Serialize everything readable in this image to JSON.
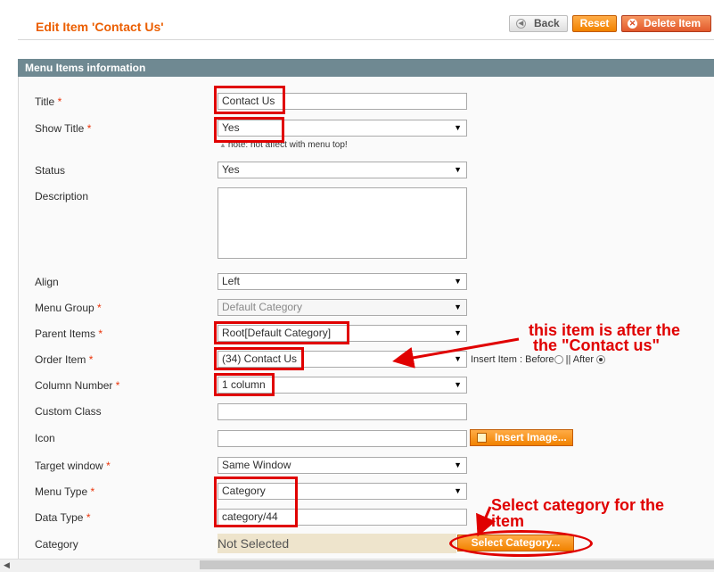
{
  "header": {
    "title": "Edit Item 'Contact Us'",
    "back_label": "Back",
    "reset_label": "Reset",
    "delete_label": "Delete Item"
  },
  "section": {
    "title": "Menu Items information"
  },
  "required_mark": "*",
  "fields": {
    "title": {
      "label": "Title",
      "value": "Contact Us"
    },
    "show_title": {
      "label": "Show Title",
      "value": "Yes",
      "note": "note: not affect with menu top!"
    },
    "status": {
      "label": "Status",
      "value": "Yes"
    },
    "description": {
      "label": "Description",
      "value": ""
    },
    "align": {
      "label": "Align",
      "value": "Left"
    },
    "menu_group": {
      "label": "Menu Group",
      "value": "Default Category"
    },
    "parent_items": {
      "label": "Parent Items",
      "value": "Root[Default Category]"
    },
    "order_item": {
      "label": "Order Item",
      "value": "(34) Contact Us",
      "insert_label": "Insert Item : Before",
      "separator": "|| After"
    },
    "column_number": {
      "label": "Column Number",
      "value": "1 column"
    },
    "custom_class": {
      "label": "Custom Class",
      "value": ""
    },
    "icon": {
      "label": "Icon",
      "value": "",
      "button": "Insert Image..."
    },
    "target_window": {
      "label": "Target window",
      "value": "Same Window"
    },
    "menu_type": {
      "label": "Menu Type",
      "value": "Category"
    },
    "data_type": {
      "label": "Data Type",
      "value": "category/44"
    },
    "category": {
      "label": "Category",
      "value": "Not Selected",
      "button": "Select Category..."
    }
  },
  "annotations": {
    "order_note_line1": "this item is after the",
    "order_note_line2": "the \"Contact us\"",
    "category_note_line1": "Select category for the",
    "category_note_line2": "item"
  },
  "colors": {
    "accent_orange": "#eb5e00",
    "section_header": "#6f8992",
    "annotation_red": "#e00000"
  }
}
